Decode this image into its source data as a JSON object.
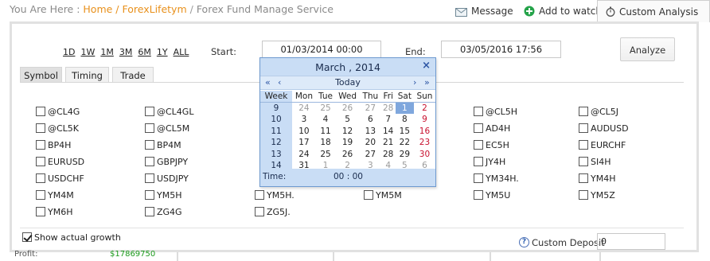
{
  "breadcrumb": {
    "prefix": "You Are Here : ",
    "home": "Home",
    "sep": " / ",
    "section": "ForexLifetym",
    "sep2": " / ",
    "current": "Forex Fund Manage Service"
  },
  "top_actions": {
    "message": "Message",
    "add_to_watch": "Add to watch",
    "custom_analysis": "Custom Analysis"
  },
  "ranges": [
    "1D",
    "1W",
    "1M",
    "3M",
    "6M",
    "1Y",
    "ALL"
  ],
  "start": {
    "label": "Start:",
    "value": "01/03/2014 00:00"
  },
  "end": {
    "label": "End:",
    "value": "03/05/2016 17:56"
  },
  "analyze_label": "Analyze",
  "tabs": [
    "Symbol",
    "Timing",
    "Trade"
  ],
  "symbols": {
    "col1": [
      "@CL4G",
      "@CL5K",
      "BP4H",
      "EURUSD",
      "USDCHF",
      "YM4M",
      "YM6H"
    ],
    "col2": [
      "@CL4GL",
      "@CL5M",
      "BP4M",
      "GBPJPY",
      "USDJPY",
      "YM5H",
      "ZG4G"
    ],
    "col3": [
      "YM5H.",
      "ZG5J."
    ],
    "col4": [
      "YM5M"
    ],
    "col5": [
      "@CL5H",
      "AD4H",
      "EC5H",
      "JY4H",
      "YM34H.",
      "YM5U"
    ],
    "col6": [
      "@CL5J",
      "AUDUSD",
      "EURCHF",
      "SI4H",
      "YM4H",
      "YM5Z"
    ]
  },
  "show_growth": "Show actual growth",
  "custom_deposit": {
    "label": "Custom Deposit",
    "value": "0"
  },
  "under": {
    "profit": "Profit:",
    "profit_value": "$17869750"
  },
  "calendar": {
    "title": "March , 2014",
    "close": "×",
    "nav": {
      "prev_year": "«",
      "prev_month": "‹",
      "today": "Today",
      "next_month": "›",
      "next_year": "»"
    },
    "header": [
      "Week",
      "Mon",
      "Tue",
      "Wed",
      "Thu",
      "Fri",
      "Sat",
      "Sun"
    ],
    "weeks": [
      [
        "9",
        "24",
        "25",
        "26",
        "27",
        "28",
        "1",
        "2"
      ],
      [
        "10",
        "3",
        "4",
        "5",
        "6",
        "7",
        "8",
        "9"
      ],
      [
        "11",
        "10",
        "11",
        "12",
        "13",
        "14",
        "15",
        "16"
      ],
      [
        "12",
        "17",
        "18",
        "19",
        "20",
        "21",
        "22",
        "23"
      ],
      [
        "13",
        "24",
        "25",
        "26",
        "27",
        "28",
        "29",
        "30"
      ],
      [
        "14",
        "31",
        "1",
        "2",
        "3",
        "4",
        "5",
        "6"
      ]
    ],
    "time_label": "Time:",
    "time_value": "00 : 00"
  },
  "colors": {
    "accent_link": "#e8901b",
    "calendar_header": "#c9ddf5",
    "calendar_selected": "#7fa7dd",
    "weekend": "#c8102e",
    "profit_green": "#1b9b1b"
  }
}
